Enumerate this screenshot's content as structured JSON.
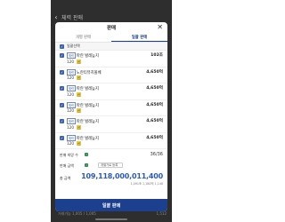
{
  "background": {
    "nav_title": "체력 판매",
    "footer_left": "거래가능 1,005 / 1,005",
    "footer_right": "1,512"
  },
  "modal": {
    "title": "판매",
    "close_icon": "close-icon",
    "tabs": [
      {
        "label": "개별 판매",
        "active": false
      },
      {
        "label": "일괄 판매",
        "active": true
      }
    ],
    "list_header": "일괄선택",
    "items": [
      {
        "type": "체력",
        "name": "파란 벌레늪지",
        "qty": "120",
        "badge": "신",
        "price": "102조"
      },
      {
        "type": "체력",
        "name": "노란티뷰치볼베",
        "qty": "120",
        "badge": "신",
        "price": "4,650억"
      },
      {
        "type": "체력",
        "name": "파란 벌레늪지",
        "qty": "120",
        "badge": "신",
        "price": "4,650억"
      },
      {
        "type": "체력",
        "name": "파란 벌레늪지",
        "qty": "120",
        "badge": "신",
        "price": "4,650억"
      },
      {
        "type": "체력",
        "name": "파란 벌레늪지",
        "qty": "120",
        "badge": "신",
        "price": "4,650억"
      },
      {
        "type": "체력",
        "name": "파란 벌레늪지",
        "qty": "120",
        "badge": "신",
        "price": "4,650억"
      }
    ],
    "summary": {
      "count_label": "판매 희망 수",
      "count_value": "36/36",
      "condition_label": "판매 금액",
      "condition_select": "개별가로 등록"
    },
    "total": {
      "label": "총 금액",
      "amount": "109,118,000,011,400",
      "sub": "1,091조 1,180억 1,140"
    },
    "sell_button": "일괄 판매"
  }
}
